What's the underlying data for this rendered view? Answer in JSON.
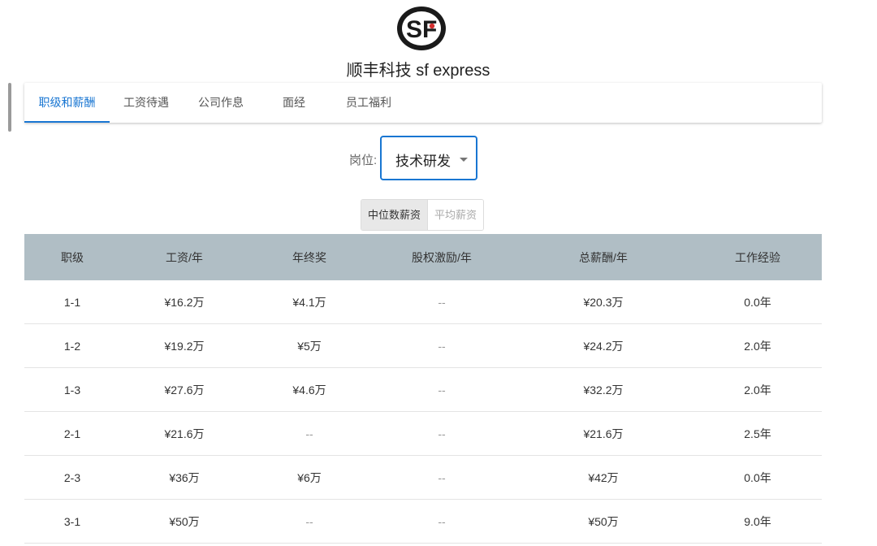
{
  "brand": {
    "name": "顺丰科技 sf express"
  },
  "tabs": [
    {
      "label": "职级和薪酬",
      "active": true
    },
    {
      "label": "工资待遇",
      "active": false
    },
    {
      "label": "公司作息",
      "active": false
    },
    {
      "label": "面经",
      "active": false
    },
    {
      "label": "员工福利",
      "active": false
    }
  ],
  "position": {
    "label": "岗位:",
    "value": "技术研发"
  },
  "toggle": {
    "median": "中位数薪资",
    "average": "平均薪资",
    "selected": "median"
  },
  "table": {
    "headers": [
      "职级",
      "工资/年",
      "年终奖",
      "股权激励/年",
      "总薪酬/年",
      "工作经验"
    ],
    "rows": [
      [
        "1-1",
        "¥16.2万",
        "¥4.1万",
        "--",
        "¥20.3万",
        "0.0年"
      ],
      [
        "1-2",
        "¥19.2万",
        "¥5万",
        "--",
        "¥24.2万",
        "2.0年"
      ],
      [
        "1-3",
        "¥27.6万",
        "¥4.6万",
        "--",
        "¥32.2万",
        "2.0年"
      ],
      [
        "2-1",
        "¥21.6万",
        "--",
        "--",
        "¥21.6万",
        "2.5年"
      ],
      [
        "2-3",
        "¥36万",
        "¥6万",
        "--",
        "¥42万",
        "0.0年"
      ],
      [
        "3-1",
        "¥50万",
        "--",
        "--",
        "¥50万",
        "9.0年"
      ]
    ]
  },
  "colors": {
    "accent": "#1976d2",
    "header_bg": "#b0bec5"
  }
}
